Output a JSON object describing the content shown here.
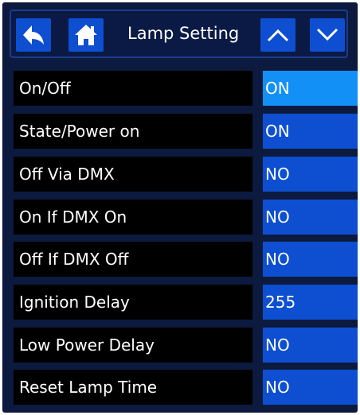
{
  "header": {
    "title": "Lamp Setting",
    "back_icon": "back-arrow-icon",
    "home_icon": "home-icon",
    "up_icon": "chevron-up-icon",
    "down_icon": "chevron-down-icon"
  },
  "settings": [
    {
      "label": "On/Off",
      "value": "ON"
    },
    {
      "label": "State/Power on",
      "value": "ON"
    },
    {
      "label": "Off Via DMX",
      "value": "NO"
    },
    {
      "label": "On If DMX On",
      "value": "NO"
    },
    {
      "label": "Off If DMX Off",
      "value": "NO"
    },
    {
      "label": "Ignition Delay",
      "value": "255"
    },
    {
      "label": "Low Power Delay",
      "value": "NO"
    },
    {
      "label": "Reset Lamp Time",
      "value": "NO"
    }
  ],
  "colors": {
    "background": "#0c1a3f",
    "button": "#0d4fd0",
    "selected_value": "#1290f5",
    "label_bg": "#000000"
  }
}
